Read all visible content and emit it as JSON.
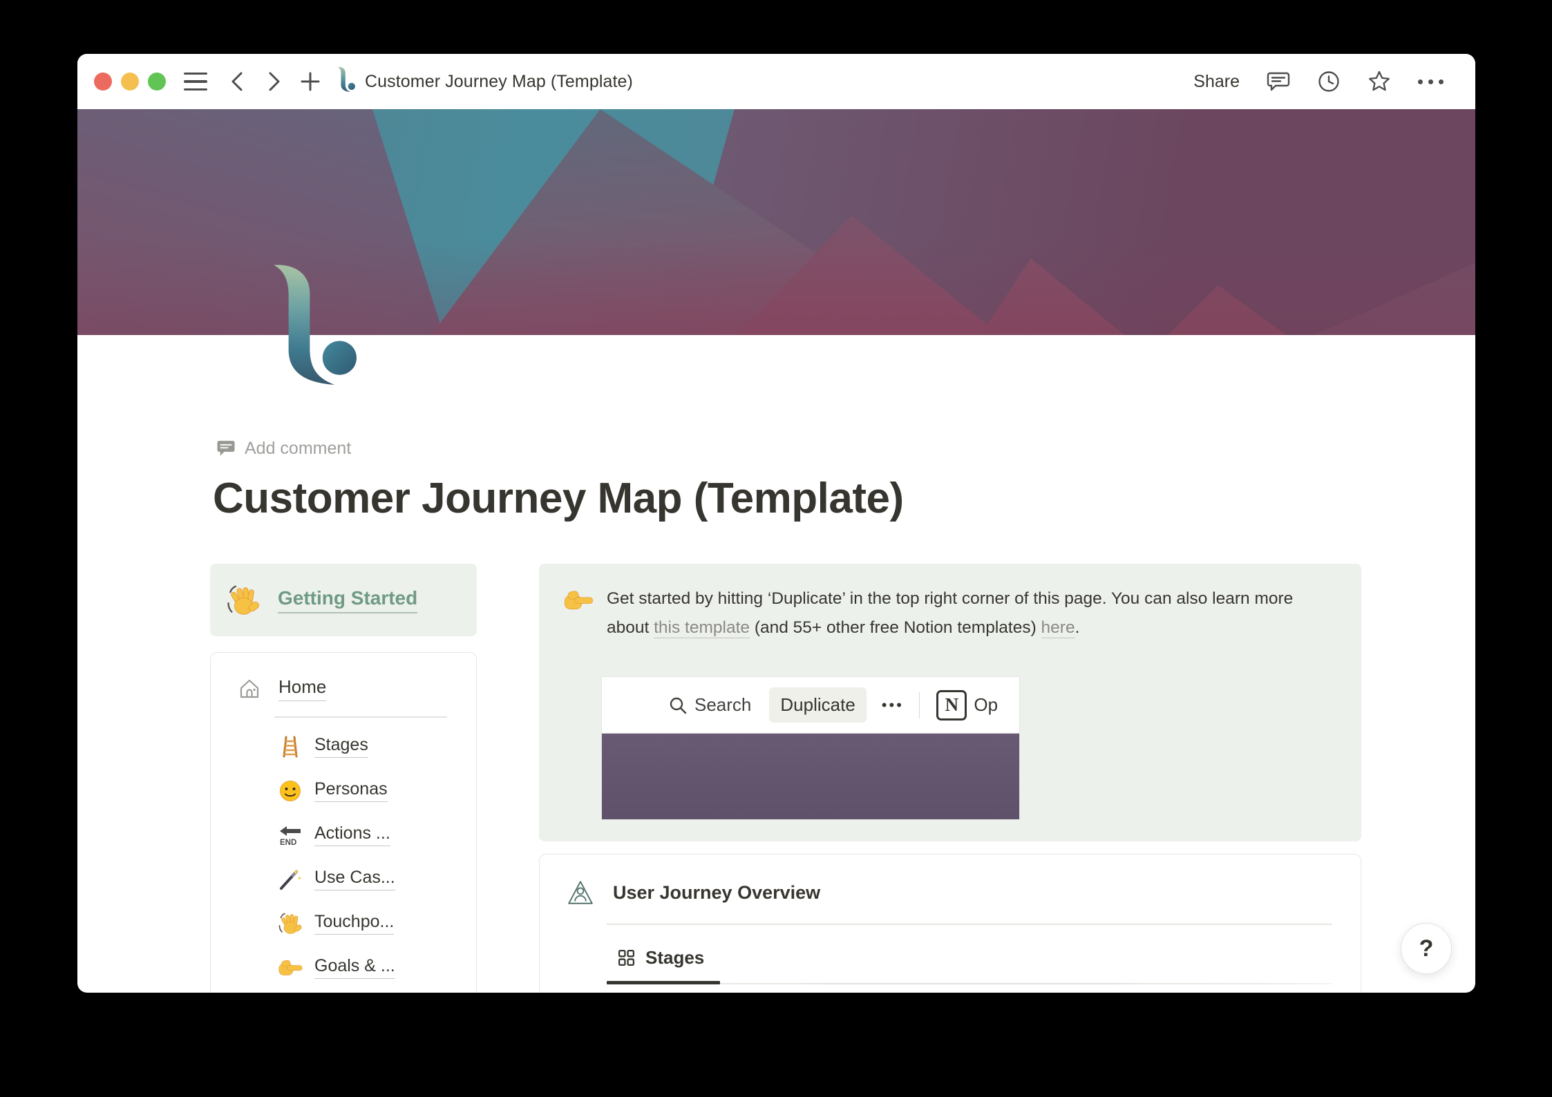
{
  "titlebar": {
    "title": "Customer Journey Map (Template)",
    "share_label": "Share"
  },
  "page": {
    "add_comment_label": "Add comment",
    "title": "Customer Journey Map (Template)"
  },
  "getting_started": {
    "label": "Getting Started"
  },
  "nav_card": {
    "home_label": "Home",
    "items": [
      {
        "icon": "ladder-icon",
        "label": "Stages"
      },
      {
        "icon": "smiley-icon",
        "label": "Personas"
      },
      {
        "icon": "end-arrow-icon",
        "label": "Actions ..."
      },
      {
        "icon": "magic-wand-icon",
        "label": "Use Cas..."
      },
      {
        "icon": "wave-icon",
        "label": "Touchpo..."
      },
      {
        "icon": "point-right-icon",
        "label": "Goals & ..."
      }
    ]
  },
  "callout": {
    "text_before_link1": "Get started by hitting ‘Duplicate’ in the top right corner of this page. You can also learn more about ",
    "link1": "this template",
    "text_between": " (and 55+ other free Notion templates) ",
    "link2": "here",
    "text_after": "."
  },
  "embedded_screenshot": {
    "search_label": "Search",
    "duplicate_label": "Duplicate",
    "more_label": "•••",
    "notion_letter": "N",
    "open_label": "Op"
  },
  "overview_card": {
    "title": "User Journey Overview",
    "tab_label": "Stages"
  },
  "help_button_label": "?",
  "end_arrow_text": "END",
  "colors": {
    "accent_green_text": "#6f9a84",
    "callout_bg": "#edf1ec",
    "cover_teal": "#4a8c9c",
    "cover_plum": "#6c465f",
    "cover_maroon": "#8a4a63",
    "embed_purple": "#63556e",
    "traffic_red": "#ed6a5e",
    "traffic_yellow": "#f5bf4f",
    "traffic_green": "#61c454"
  }
}
